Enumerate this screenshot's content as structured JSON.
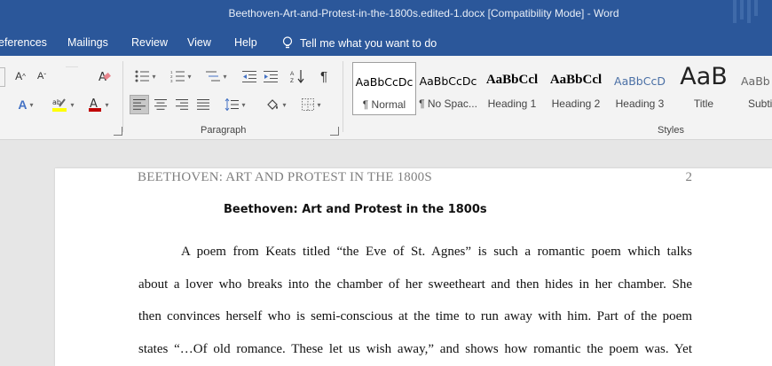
{
  "titlebar": {
    "title": "Beethoven-Art-and-Protest-in-the-1800s.edited-1.docx [Compatibility Mode]  -  Word"
  },
  "tabs": [
    {
      "label": "eferences"
    },
    {
      "label": "Mailings"
    },
    {
      "label": "Review"
    },
    {
      "label": "View"
    },
    {
      "label": "Help"
    }
  ],
  "tellme": {
    "label": "Tell me what you want to do",
    "icon": "lightbulb-icon"
  },
  "ribbon": {
    "paragraph_label": "Paragraph",
    "styles_label": "Styles",
    "styles": [
      {
        "preview": "AaBbCcDc",
        "name": "¶ Normal",
        "selected": true
      },
      {
        "preview": "AaBbCcDc",
        "name": "¶ No Spac..."
      },
      {
        "preview": "AaBbCcl",
        "name": "Heading 1"
      },
      {
        "preview": "AaBbCcl",
        "name": "Heading 2"
      },
      {
        "preview": "AaBbCcD",
        "name": "Heading 3"
      },
      {
        "preview": "AaB",
        "name": "Title"
      },
      {
        "preview": "AaBb",
        "name": "Subti"
      }
    ],
    "colors": {
      "highlight": "#ffff00",
      "font_color": "#c00000",
      "accent": "#2b579a"
    }
  },
  "document": {
    "running_head": "BEETHOVEN: ART AND PROTEST IN THE 1800S",
    "page_number": "2",
    "title": "Beethoven: Art and Protest in the 1800s",
    "lines": [
      "A poem from Keats titled “the Eve of St. Agnes” is such a romantic poem which talks",
      "about a lover who breaks into the chamber of her sweetheart and then hides in her chamber. She",
      "then convinces herself who is semi-conscious at the time to run away with him. Part of the poem",
      "states “…Of old romance. These let us wish away,” and shows how romantic the poem was. Yet"
    ]
  }
}
